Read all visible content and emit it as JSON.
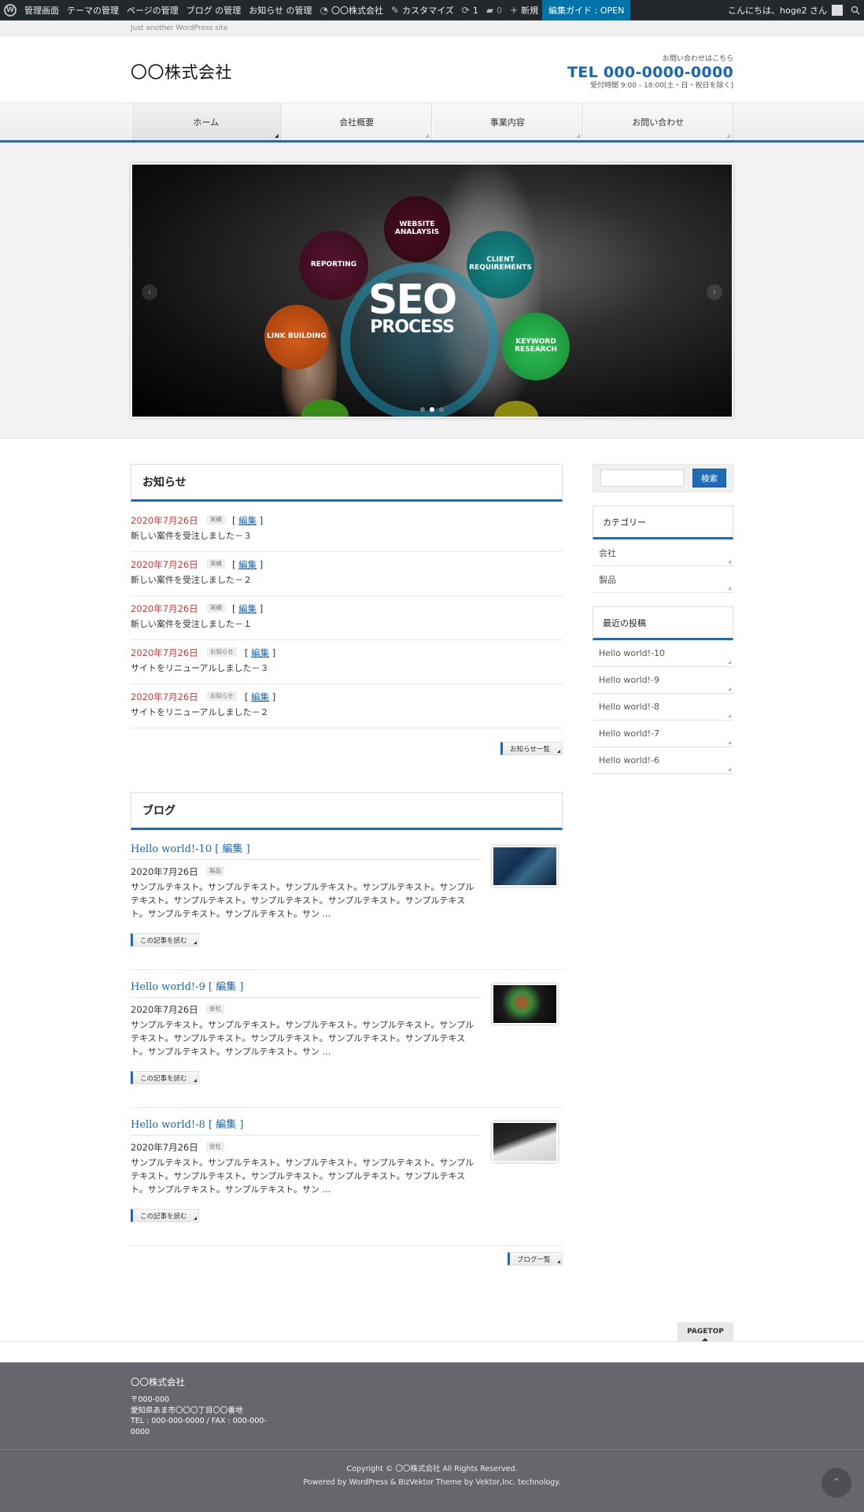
{
  "admin_bar": {
    "items": [
      "管理画面",
      "テーマの管理",
      "ページの管理",
      "ブログ の管理",
      "お知らせ の管理"
    ],
    "site_name": "〇〇株式会社",
    "customize": "カスタマイズ",
    "updates": "1",
    "comments": "0",
    "new": "新規",
    "guide": "編集ガイド : OPEN",
    "greeting": "こんにちは、hoge2 さん"
  },
  "site": {
    "tagline": "Just another WordPress site",
    "logo": "〇〇株式会社",
    "contact_lead": "お問い合わせはこちら",
    "tel": "TEL 000-0000-0000",
    "hours": "受付時間 9:00 - 18:00[土・日・祝日を除く]"
  },
  "nav": [
    {
      "label": "ホーム"
    },
    {
      "label": "会社概要"
    },
    {
      "label": "事業内容"
    },
    {
      "label": "お問い合わせ"
    }
  ],
  "slider": {
    "bubbles": [
      "WEBSITE ANALAYSIS",
      "REPORTING",
      "CLIENT REQUIREMENTS",
      "LINK BUILDING",
      "KEYWORD RESEARCH"
    ],
    "seo_a": "SEO",
    "seo_b": "PROCESS"
  },
  "news": {
    "heading": "お知らせ",
    "edit_label": "編集",
    "items": [
      {
        "date": "2020年7月26日",
        "tag": "実績",
        "title": "新しい案件を受注しました－３"
      },
      {
        "date": "2020年7月26日",
        "tag": "実績",
        "title": "新しい案件を受注しました－２"
      },
      {
        "date": "2020年7月26日",
        "tag": "実績",
        "title": "新しい案件を受注しました－１"
      },
      {
        "date": "2020年7月26日",
        "tag": "お知らせ",
        "title": "サイトをリニューアルしました－３"
      },
      {
        "date": "2020年7月26日",
        "tag": "お知らせ",
        "title": "サイトをリニューアルしました－２"
      }
    ],
    "more": "お知らせ一覧"
  },
  "blog": {
    "heading": "ブログ",
    "read_more": "この記事を読む",
    "edit": "[ 編集 ]",
    "posts": [
      {
        "title": "Hello world!-10",
        "date": "2020年7月26日",
        "tag": "製品",
        "excerpt": "サンプルテキスト。サンプルテキスト。サンプルテキスト。サンプルテキスト。サンプルテキスト。サンプルテキスト。サンプルテキスト。サンプルテキスト。サンプルテキスト。サンプルテキスト。サンプルテキスト。サン …"
      },
      {
        "title": "Hello world!-9",
        "date": "2020年7月26日",
        "tag": "会社",
        "excerpt": "サンプルテキスト。サンプルテキスト。サンプルテキスト。サンプルテキスト。サンプルテキスト。サンプルテキスト。サンプルテキスト。サンプルテキスト。サンプルテキスト。サンプルテキスト。サンプルテキスト。サン …"
      },
      {
        "title": "Hello world!-8",
        "date": "2020年7月26日",
        "tag": "会社",
        "excerpt": "サンプルテキスト。サンプルテキスト。サンプルテキスト。サンプルテキスト。サンプルテキスト。サンプルテキスト。サンプルテキスト。サンプルテキスト。サンプルテキスト。サンプルテキスト。サンプルテキスト。サン …"
      }
    ],
    "more": "ブログ一覧"
  },
  "sidebar": {
    "search_button": "検索",
    "categories_heading": "カテゴリー",
    "categories": [
      "会社",
      "製品"
    ],
    "recent_heading": "最近の投稿",
    "recent": [
      "Hello world!-10",
      "Hello world!-9",
      "Hello world!-8",
      "Hello world!-7",
      "Hello world!-6"
    ]
  },
  "pagetop": "PAGETOP",
  "footer": {
    "name": "〇〇株式会社",
    "zip": "〒000-000",
    "address": "愛知県あま市〇〇〇丁目〇〇番地",
    "tel": "TEL : 000-000-0000 / FAX : 000-000-0000",
    "copyright": "Copyright © 〇〇株式会社 All Rights Reserved.",
    "powered": "Powered by WordPress & BizVektor Theme by Vektor,Inc. technology."
  }
}
